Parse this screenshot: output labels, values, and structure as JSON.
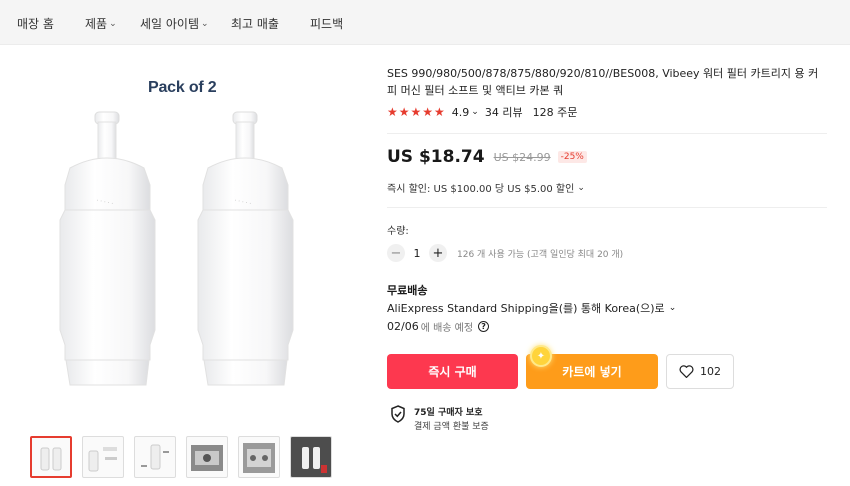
{
  "nav": {
    "items": [
      {
        "label": "매장 홈",
        "chevron": false
      },
      {
        "label": "제품",
        "chevron": true
      },
      {
        "label": "세일 아이템",
        "chevron": true
      },
      {
        "label": "최고 매출",
        "chevron": false
      },
      {
        "label": "피드백",
        "chevron": false
      }
    ]
  },
  "gallery": {
    "main_caption": "Pack of 2",
    "thumbnails": [
      "thumb-1",
      "thumb-2",
      "thumb-3",
      "thumb-4",
      "thumb-5",
      "thumb-6"
    ],
    "active_thumbnail": 0
  },
  "product": {
    "title": "SES 990/980/500/878/875/880/920/810//BES008, Vibeey 워터 필터 카트리지 용 커피 머신 필터 소프트 및 액티브 카본 쿼",
    "rating": "4.9",
    "rating_chevron": "⌄",
    "reviews": "34 리뷰",
    "orders": "128 주문",
    "price": "US $18.74",
    "old_price": "US $24.99",
    "discount": "-25%",
    "coupon": "즉시 할인: US $100.00 당 US $5.00 할인",
    "quantity_label": "수량:",
    "quantity": "1",
    "minus": "−",
    "plus": "+",
    "quantity_note": "126 개 사용 가능 (고객 일인당 최대 20 개)"
  },
  "shipping": {
    "title": "무료배송",
    "method": "AliExpress Standard Shipping을(를) 통해 Korea(으)로",
    "date": "02/06",
    "date_suffix": "에 배송 예정",
    "help": "?"
  },
  "actions": {
    "buy_label": "즉시 구매",
    "cart_label": "카트에 넣기",
    "wishlist_count": "102"
  },
  "protection": {
    "line1": "75일 구매자 보호",
    "line2": "결제 금액 환불 보증"
  },
  "colors": {
    "accent_red": "#fd384f",
    "accent_orange": "#fe9c1a",
    "star_red": "#e63c2f"
  }
}
